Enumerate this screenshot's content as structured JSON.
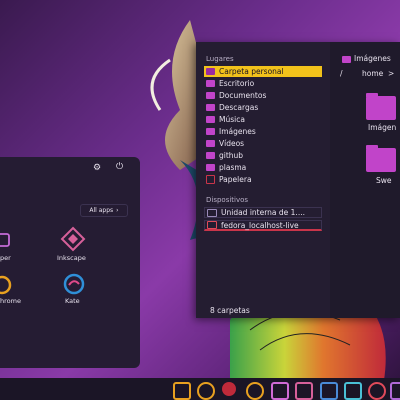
{
  "file_manager": {
    "places_title": "Lugares",
    "places": [
      {
        "label": "Carpeta personal",
        "active": true
      },
      {
        "label": "Escritorio"
      },
      {
        "label": "Documentos"
      },
      {
        "label": "Descargas"
      },
      {
        "label": "Música"
      },
      {
        "label": "Imágenes"
      },
      {
        "label": "Vídeos"
      },
      {
        "label": "github"
      },
      {
        "label": "plasma"
      },
      {
        "label": "Papelera"
      }
    ],
    "devices_title": "Dispositivos",
    "devices": [
      {
        "label": "Unidad interna de 1...."
      },
      {
        "label": "fedora_localhost-live"
      }
    ],
    "breadcrumb": {
      "sep": "/",
      "current": "home",
      "arrow": ">"
    },
    "top_folder": "Imágenes",
    "folders": [
      {
        "label": "Imágen"
      },
      {
        "label": "Swe"
      }
    ],
    "status": "8 carpetas"
  },
  "launcher": {
    "all_apps": "All apps",
    "apps": [
      {
        "label": "per"
      },
      {
        "label": "Inkscape"
      },
      {
        "label": "hrome"
      },
      {
        "label": "Kate"
      }
    ]
  },
  "colors": {
    "accent": "#f2c21b",
    "folder": "#c144c9",
    "panel": "#1f1a2b"
  }
}
